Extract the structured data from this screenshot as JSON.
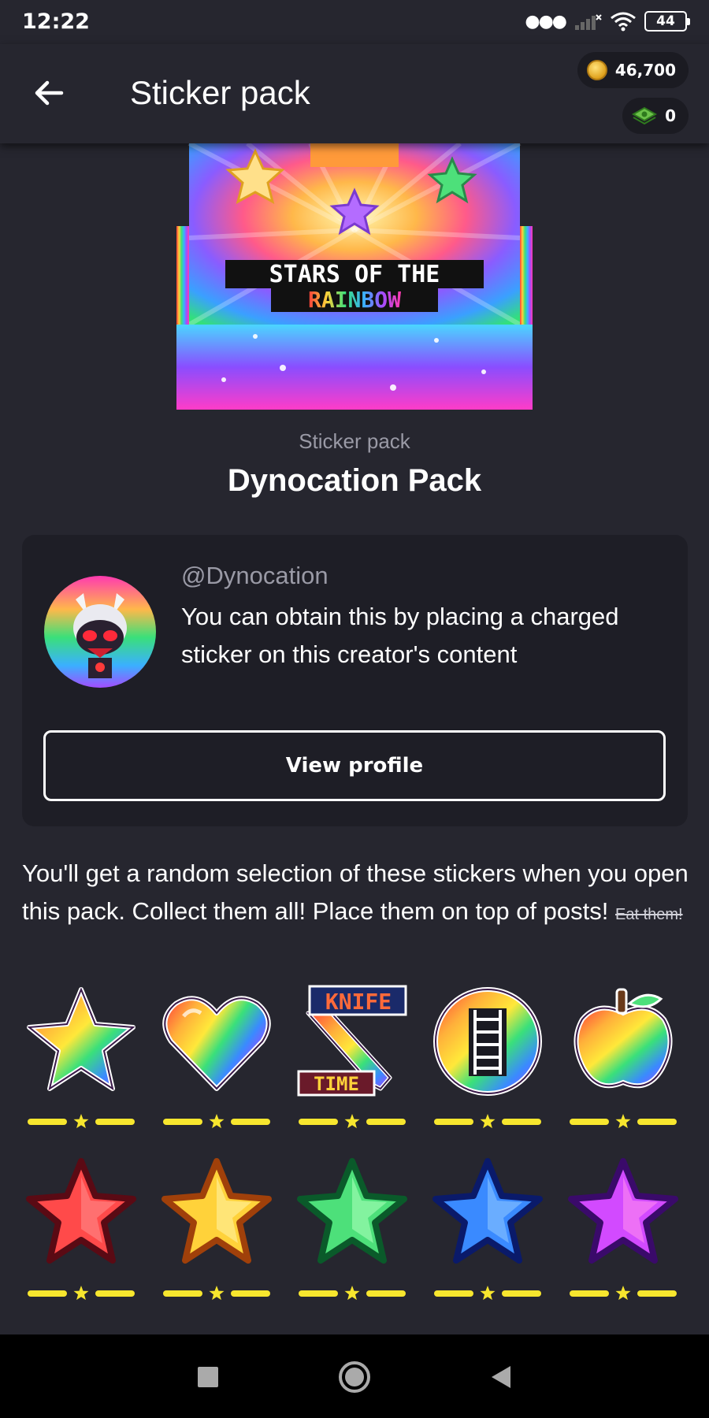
{
  "status": {
    "time": "12:22",
    "battery": "44"
  },
  "app_bar": {
    "title": "Sticker pack",
    "coins": "46,700",
    "cash": "0"
  },
  "pack": {
    "banner_line1": "STARS OF THE",
    "banner_line2": "RAINBOW",
    "subtitle": "Sticker pack",
    "name": "Dynocation Pack"
  },
  "creator": {
    "handle": "@Dynocation",
    "description": "You can obtain this by placing a charged sticker on this creator's content",
    "view_profile": "View profile"
  },
  "info": {
    "text": "You'll get a random selection of these stickers when you open this pack. Collect them all! Place them on top of posts!",
    "strikethrough": "Eat them!"
  },
  "stickers": [
    {
      "name": "rainbow-star",
      "knife_text_top": "",
      "knife_text_bottom": "",
      "rarity_stars": 1
    },
    {
      "name": "rainbow-heart",
      "rarity_stars": 1
    },
    {
      "name": "knife-time",
      "knife_text_top": "KNIFE",
      "knife_text_bottom": "TIME",
      "rarity_stars": 1
    },
    {
      "name": "rainbow-ladder-badge",
      "rarity_stars": 1
    },
    {
      "name": "rainbow-apple",
      "rarity_stars": 1
    },
    {
      "name": "red-star",
      "rarity_stars": 1
    },
    {
      "name": "yellow-star",
      "rarity_stars": 1
    },
    {
      "name": "green-star",
      "rarity_stars": 1
    },
    {
      "name": "blue-star",
      "rarity_stars": 1
    },
    {
      "name": "purple-star",
      "rarity_stars": 1
    }
  ],
  "colors": {
    "background": "#26262f",
    "card": "#1e1e26",
    "rarity": "#f7e62e",
    "muted_text": "#9a9aa6"
  }
}
